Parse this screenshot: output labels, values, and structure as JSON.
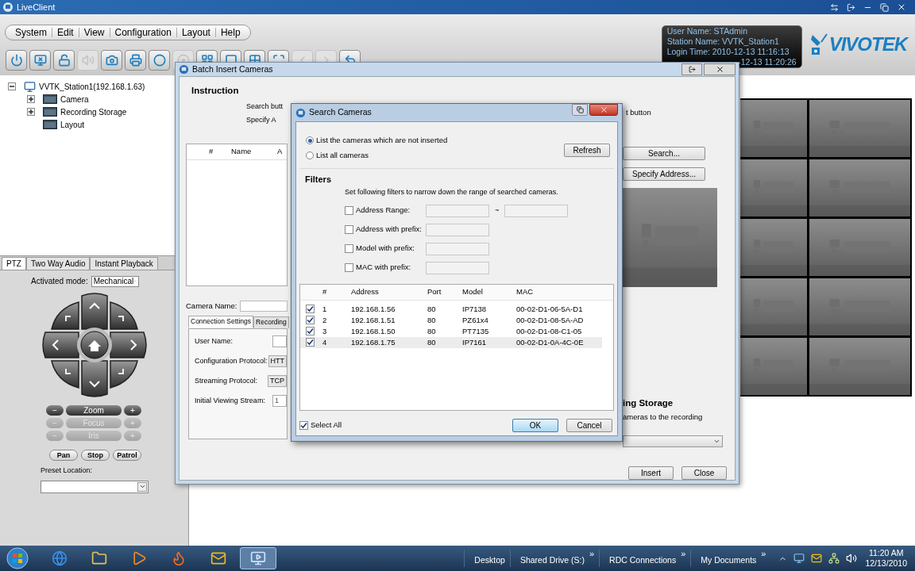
{
  "window": {
    "title": "LiveClient"
  },
  "menu": [
    "System",
    "Edit",
    "View",
    "Configuration",
    "Layout",
    "Help"
  ],
  "toolbar": [
    {
      "disabled": false
    },
    {
      "disabled": false
    },
    {
      "disabled": false
    },
    {
      "disabled": true
    },
    {
      "disabled": false
    },
    {
      "disabled": false
    },
    {
      "disabled": false
    },
    {
      "disabled": true
    },
    {
      "disabled": false
    },
    {
      "disabled": false
    },
    {
      "disabled": false
    },
    {
      "disabled": false
    },
    {
      "disabled": true
    },
    {
      "disabled": true
    },
    {
      "disabled": false
    }
  ],
  "session": [
    "User Name: STAdmin",
    "Station Name: VVTK_Station1",
    "Login Time: 2010-12-13 11:16:13",
    "-12-13 11:20:26"
  ],
  "logo": "VIVOTEK",
  "tree": [
    {
      "label": "VVTK_Station1(192.168.1.63)",
      "expandable": true,
      "expanded": true,
      "children": [
        {
          "label": "Camera",
          "expandable": true,
          "expanded": false
        },
        {
          "label": "Recording Storage",
          "expandable": true,
          "expanded": false
        },
        {
          "label": "Layout",
          "expandable": false
        }
      ]
    }
  ],
  "ptz": {
    "tabs": [
      {
        "label": "PTZ",
        "selected": true
      },
      {
        "label": "Two Way Audio",
        "selected": false
      },
      {
        "label": "Instant Playback",
        "selected": false
      }
    ],
    "mode_label": "Activated mode:",
    "mode": "Mechanical",
    "lens": [
      {
        "minus": "−",
        "label": "Zoom",
        "plus": "+",
        "disabled": false
      },
      {
        "minus": "−",
        "label": "Focus",
        "plus": "+",
        "disabled": true
      },
      {
        "minus": "−",
        "label": "Iris",
        "plus": "+",
        "disabled": true
      }
    ],
    "buttons": [
      "Pan",
      "Stop",
      "Patrol"
    ],
    "preset_label": "Preset Location:"
  },
  "views": [
    {
      "kind": "picture"
    },
    {
      "kind": "picture"
    },
    {
      "kind": "picture"
    },
    {
      "kind": "picture"
    },
    {
      "kind": "picture"
    },
    {
      "kind": "picture"
    },
    {
      "kind": "picture"
    },
    {
      "kind": "picture"
    },
    {
      "kind": "picture"
    },
    {
      "kind": "picture"
    }
  ],
  "batch": {
    "title": "Batch Insert Cameras",
    "instruction_title": "Instruction",
    "instruction_left": [
      "Search butt",
      "Specify A"
    ],
    "instruction_right": "t button",
    "columns": [
      "#",
      "Name",
      "A"
    ],
    "side_buttons": [
      "Search...",
      "Specify Address..."
    ],
    "preview": {
      "kind": "picture"
    },
    "camera_name_label": "Camera Name:",
    "tabs": [
      {
        "label": "Connection Settings",
        "selected": true
      },
      {
        "label": "Recording",
        "selected": false
      }
    ],
    "fields": [
      {
        "label": "User Name:",
        "kind": "text"
      },
      {
        "label": "Configuration Protocol:",
        "kind": "select",
        "value": "HTT"
      },
      {
        "label": "Streaming Protocol:",
        "kind": "select",
        "value": "TCP"
      },
      {
        "label": "Initial Viewing Stream:",
        "kind": "text",
        "value": "1"
      }
    ],
    "storage_title": "ing Storage",
    "storage_text": "ameras to the recording",
    "footer_buttons": [
      "Insert",
      "Close"
    ]
  },
  "search": {
    "title": "Search Cameras",
    "modes": [
      {
        "label": "List the cameras which are not inserted",
        "selected": true
      },
      {
        "label": "List all cameras",
        "selected": false
      }
    ],
    "refresh": "Refresh",
    "filters_title": "Filters",
    "filters_hint": "Set following filters to narrow down the range of searched cameras.",
    "filters": [
      {
        "label": "Address Range:",
        "checked": false,
        "kind": "range",
        "separator": "~"
      },
      {
        "label": "Address with prefix:",
        "checked": false,
        "kind": "single"
      },
      {
        "label": "Model with prefix:",
        "checked": false,
        "kind": "single"
      },
      {
        "label": "MAC with prefix:",
        "checked": false,
        "kind": "single"
      }
    ],
    "columns": [
      "#",
      "Address",
      "Port",
      "Model",
      "MAC"
    ],
    "rows": [
      {
        "checked": true,
        "selected": false,
        "cells": [
          "1",
          "192.168.1.56",
          "80",
          "IP7138",
          "00-02-D1-06-5A-D1"
        ]
      },
      {
        "checked": true,
        "selected": false,
        "cells": [
          "2",
          "192.168.1.51",
          "80",
          "PZ61x4",
          "00-02-D1-08-5A-AD"
        ]
      },
      {
        "checked": true,
        "selected": false,
        "cells": [
          "3",
          "192.168.1.50",
          "80",
          "PT7135",
          "00-02-D1-08-C1-05"
        ]
      },
      {
        "checked": true,
        "selected": true,
        "cells": [
          "4",
          "192.168.1.75",
          "80",
          "IP7161",
          "00-02-D1-0A-4C-0E"
        ]
      }
    ],
    "select_all": {
      "label": "Select All",
      "checked": true
    },
    "buttons": [
      {
        "label": "OK",
        "focused": true
      },
      {
        "label": "Cancel",
        "focused": false
      }
    ]
  },
  "taskbar": {
    "pinned": [
      {
        "active": false
      },
      {
        "active": false
      },
      {
        "active": false
      },
      {
        "active": false
      },
      {
        "active": false
      },
      {
        "active": true
      }
    ],
    "toolbars": [
      {
        "label": "Desktop"
      },
      {
        "label": "Shared Drive (S:)",
        "chevron": "»"
      },
      {
        "label": "RDC Connections",
        "chevron": "»"
      },
      {
        "label": "My Documents",
        "chevron": "»"
      }
    ],
    "time": "11:20 AM",
    "date": "12/13/2010"
  }
}
